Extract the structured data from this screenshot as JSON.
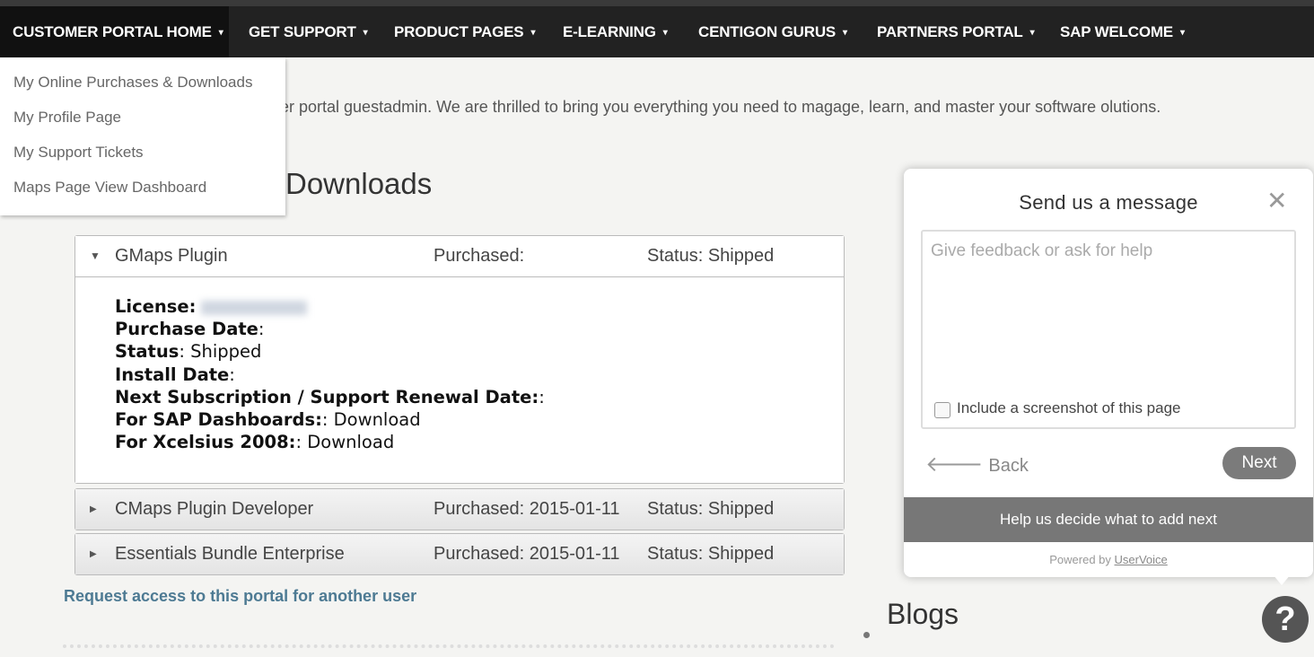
{
  "nav": {
    "items": [
      {
        "label": "CUSTOMER PORTAL HOME",
        "active": true
      },
      {
        "label": "GET SUPPORT"
      },
      {
        "label": "PRODUCT PAGES"
      },
      {
        "label": "E-LEARNING"
      },
      {
        "label": "CENTIGON GURUS"
      },
      {
        "label": "PARTNERS PORTAL"
      },
      {
        "label": "SAP WELCOME"
      }
    ],
    "caret": "▾"
  },
  "dropdown": {
    "items": [
      "My Online Purchases & Downloads",
      "My Profile Page",
      "My Support Tickets",
      "Maps Page View Dashboard"
    ]
  },
  "intro": {
    "text": "er portal guestadmin. We are thrilled to bring you everything you need to magage, learn, and master your software olutions."
  },
  "section": {
    "title": "Downloads"
  },
  "purchases": [
    {
      "name": "GMaps Plugin",
      "purchased": "Purchased:",
      "status": "Status: Shipped",
      "open": true,
      "details": {
        "license_label": "License:",
        "purchase_date_label": "Purchase Date",
        "status_label": "Status",
        "status_value": "Shipped",
        "install_date_label": "Install Date",
        "renewal_label": "Next Subscription / Support Renewal Date:",
        "sap_label": "For SAP Dashboards:",
        "sap_link": "Download",
        "xcelsius_label": "For Xcelsius 2008:",
        "xcelsius_link": "Download"
      }
    },
    {
      "name": "CMaps Plugin Developer",
      "purchased": "Purchased: 2015-01-11",
      "status": "Status: Shipped",
      "open": false
    },
    {
      "name": "Essentials Bundle Enterprise",
      "purchased": "Purchased: 2015-01-11",
      "status": "Status: Shipped",
      "open": false
    }
  ],
  "request_link": "Request access to this portal for another user",
  "blogs_title": "Blogs",
  "widget": {
    "title": "Send us a message",
    "close": "✕",
    "placeholder": "Give feedback or ask for help",
    "checkbox_label": "Include a screenshot of this page",
    "back": "Back",
    "next": "Next",
    "bar": "Help us decide what to add next",
    "powered_prefix": "Powered by",
    "powered_link": "UserVoice"
  },
  "help_button": "?",
  "icons": {
    "caret": "chevron-down-icon",
    "open_arrow": "triangle-down-icon",
    "closed_arrow": "triangle-right-icon",
    "back": "arrow-left-icon",
    "help": "question-icon"
  }
}
